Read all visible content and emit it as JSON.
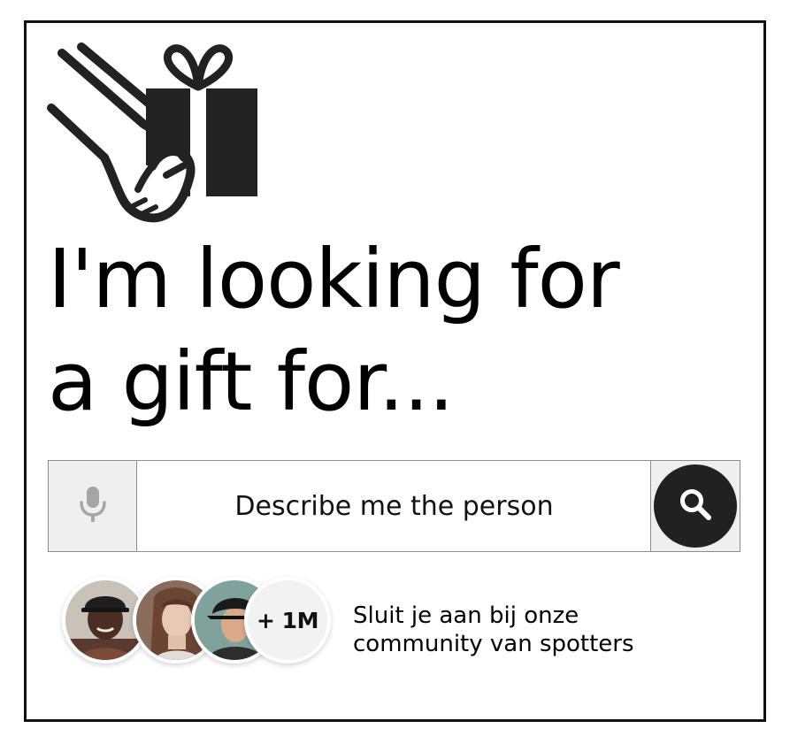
{
  "logo": {
    "icon": "hand-giving-gift-icon"
  },
  "headline": {
    "line1": "I'm looking for",
    "line2": "a gift for..."
  },
  "search": {
    "mic_icon": "microphone-icon",
    "placeholder": "Describe me the person",
    "search_icon": "search-icon"
  },
  "community": {
    "avatars": [
      {
        "icon": "avatar-man-cap"
      },
      {
        "icon": "avatar-woman"
      },
      {
        "icon": "avatar-woman-hat"
      }
    ],
    "more_count": "+ 1M",
    "text_line1": "Sluit je aan bij onze",
    "text_line2": "community van spotters"
  },
  "colors": {
    "border": "#111111",
    "button_dark": "#212121",
    "button_bg": "#efefef",
    "mic": "#9e9e9e"
  }
}
